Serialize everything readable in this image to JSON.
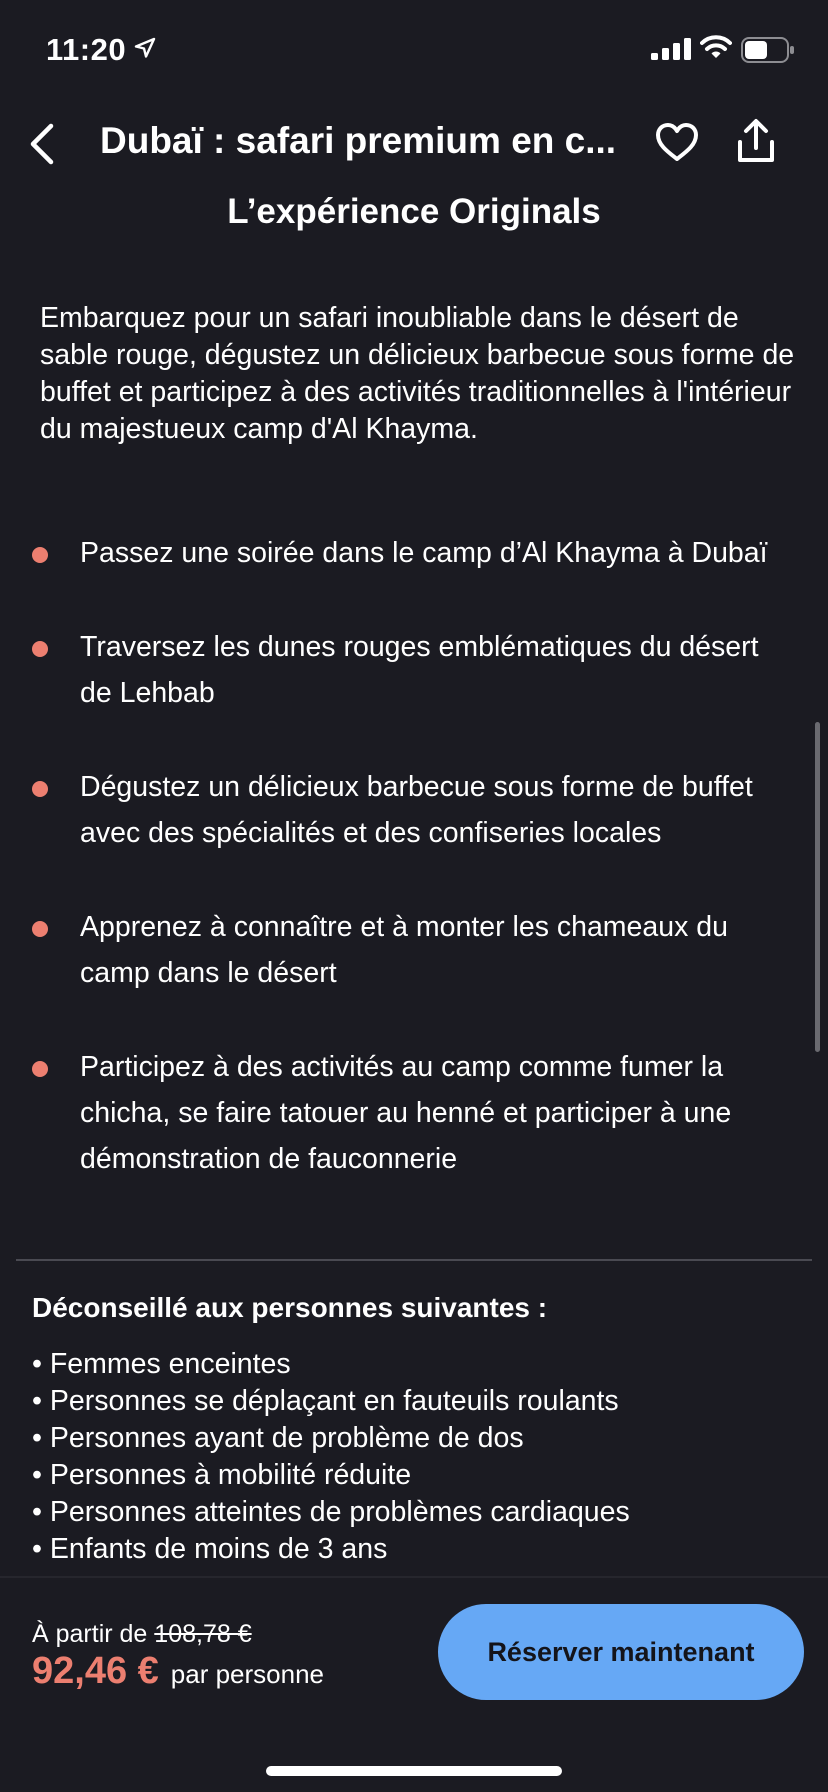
{
  "status": {
    "time": "11:20",
    "icons": [
      "location-arrow-icon",
      "signal-icon",
      "wifi-icon",
      "battery-icon"
    ]
  },
  "header": {
    "title": "Dubaï : safari premium en c...",
    "icons": [
      "back-arrow-icon",
      "heart-icon",
      "share-icon"
    ]
  },
  "section": {
    "title": "L’expérience Originals",
    "intro": "Embarquez pour un safari inoubliable dans le désert de sable rouge, dégustez un délicieux barbecue sous forme de buffet et participez à des activités traditionnelles à l'intérieur du majestueux camp d'Al Khayma."
  },
  "highlights": [
    {
      "text": "Passez une soirée dans le camp d’Al Khayma à Dubaï"
    },
    {
      "text": "Traversez les dunes rouges emblématiques du désert de Lehbab"
    },
    {
      "text": "Dégustez un délicieux barbecue sous forme de buffet avec des spécialités et des confiseries locales"
    },
    {
      "text": "Apprenez à connaître et à monter les chameaux du camp dans le désert"
    },
    {
      "text": "Participez à des activités au camp comme fumer la chicha, se faire tatouer au henné et participer à une démonstration de fauconnerie"
    }
  ],
  "warnings": {
    "title": "Déconseillé aux personnes suivantes :",
    "items": [
      "• Femmes enceintes",
      "• Personnes se déplaçant en fauteuils roulants",
      "• Personnes ayant de problème de dos",
      "• Personnes à mobilité réduite",
      "• Personnes atteintes de problèmes cardiaques",
      "• Enfants de moins de 3 ans"
    ]
  },
  "booking": {
    "from_label": "À partir de",
    "old_price": "108,78 €",
    "price": "92,46 €",
    "per_person": "par personne",
    "button_label": "Réserver maintenant"
  },
  "colors": {
    "background": "#1b1b22",
    "accent": "#ec7f70",
    "button": "#66a8f5"
  }
}
